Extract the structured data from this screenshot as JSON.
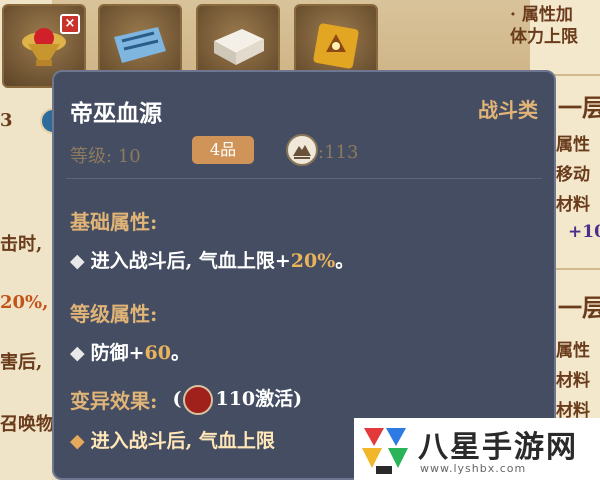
{
  "background": {
    "right_lines": [
      "· 属性加",
      "体力上限",
      "一层",
      "属性",
      "移动",
      "材料",
      "+10",
      "一层",
      "属性",
      "材料",
      "材料"
    ],
    "left_lines": [
      "3",
      "击时,",
      "20%,",
      "害后,",
      "召唤物"
    ]
  },
  "slots": [
    {
      "icon": "blood-chalice-icon",
      "removable": true
    },
    {
      "icon": "blue-scroll-icon",
      "removable": false
    },
    {
      "icon": "white-box-icon",
      "removable": false
    },
    {
      "icon": "golden-tome-icon",
      "removable": false
    }
  ],
  "tooltip": {
    "name": "帝巫血源",
    "category": "战斗类",
    "level_text": "等级: 10",
    "grade": "4品",
    "potential_value": ":113",
    "basic_title": "基础属性:",
    "basic_line_prefix": "进入战斗后, 气血上限+",
    "basic_line_num": "20%",
    "basic_line_suffix": "。",
    "level_title": "等级属性:",
    "level_line_prefix": "防御+",
    "level_line_num": "60",
    "level_line_suffix": "。",
    "mutation_title": "变异效果:",
    "mutation_req_open": "(",
    "mutation_req_text": "110激活)",
    "mutation_line": "进入战斗后, 气血上限"
  },
  "watermark": {
    "title": "八星手游网",
    "url": "www.lyshbx.com"
  }
}
